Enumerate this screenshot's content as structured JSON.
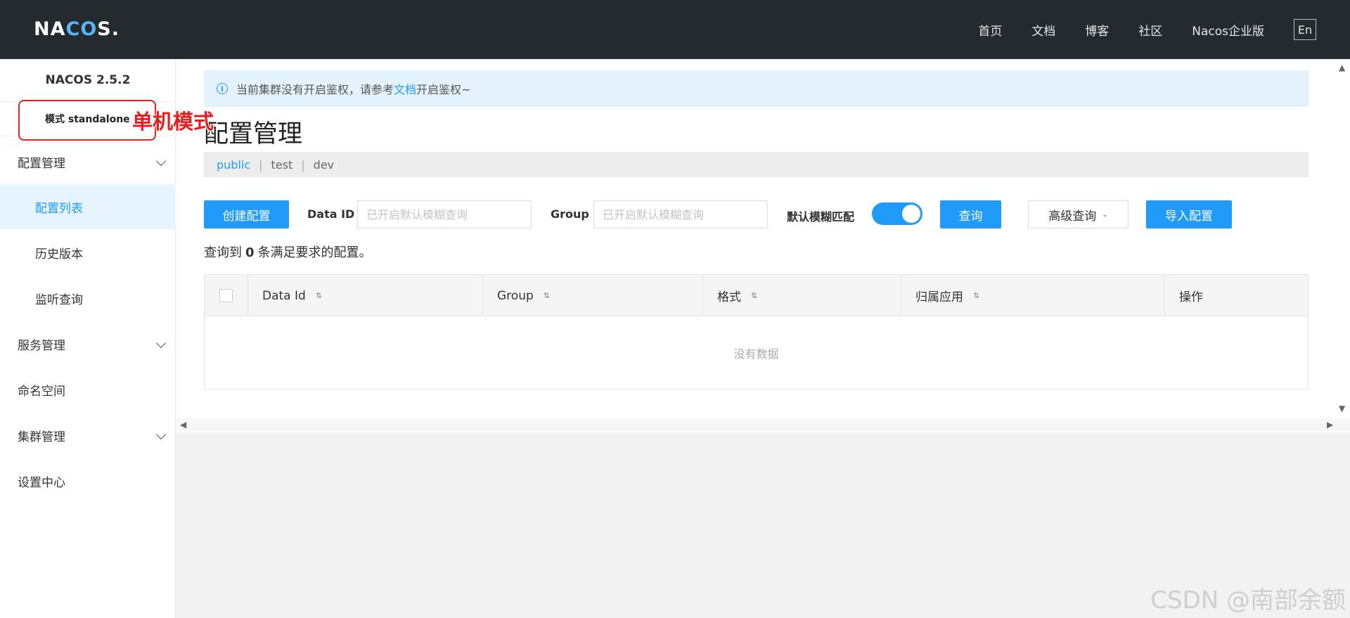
{
  "header": {
    "logo_prefix": "NA",
    "logo_co": "CO",
    "logo_suffix": "S.",
    "nav": [
      "首页",
      "文档",
      "博客",
      "社区",
      "Nacos企业版"
    ],
    "lang": "En"
  },
  "sidebar": {
    "version": "NACOS 2.5.2",
    "mode_label": "模式",
    "mode_value": "standalone",
    "annotation": "单机模式",
    "items": [
      {
        "label": "配置管理"
      },
      {
        "label": "配置列表"
      },
      {
        "label": "历史版本"
      },
      {
        "label": "监听查询"
      },
      {
        "label": "服务管理"
      },
      {
        "label": "命名空间"
      },
      {
        "label": "集群管理"
      },
      {
        "label": "设置中心"
      }
    ]
  },
  "alert": {
    "text_before": "当前集群没有开启鉴权，请参考",
    "link": "文档",
    "text_after": "开启鉴权~"
  },
  "page": {
    "title": "配置管理",
    "namespaces": [
      "public",
      "test",
      "dev"
    ]
  },
  "search": {
    "create_btn": "创建配置",
    "data_id_label": "Data ID",
    "data_id_placeholder": "已开启默认模糊查询",
    "group_label": "Group",
    "group_placeholder": "已开启默认模糊查询",
    "fuzzy_label": "默认模糊匹配",
    "fuzzy_on": true,
    "query_btn": "查询",
    "advanced_btn": "高级查询",
    "import_btn": "导入配置"
  },
  "result": {
    "prefix": "查询到",
    "count": "0",
    "suffix": "条满足要求的配置。"
  },
  "table": {
    "columns": [
      "Data Id",
      "Group",
      "格式",
      "归属应用",
      "操作"
    ],
    "empty": "没有数据"
  },
  "watermark": "CSDN @南部余额",
  "colors": {
    "accent": "#209bfa",
    "header_bg": "#252a2f",
    "annotation": "#e81d1d"
  }
}
